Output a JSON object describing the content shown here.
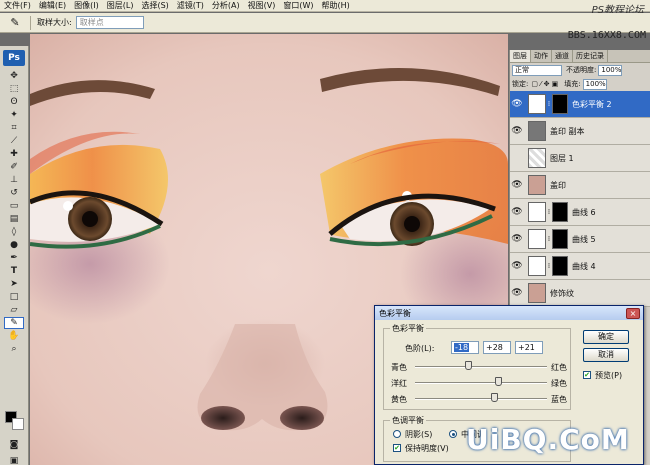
{
  "menubar": {
    "items": [
      "文件(F)",
      "编辑(E)",
      "图像(I)",
      "图层(L)",
      "选择(S)",
      "滤镜(T)",
      "分析(A)",
      "视图(V)",
      "窗口(W)",
      "帮助(H)"
    ],
    "watermark": "PS教程论坛"
  },
  "options": {
    "sample_size_label": "取样大小:",
    "sample_size_value": "取样点",
    "watermark": "BBS.16XX8.COM"
  },
  "toolbox": {
    "logo": "Ps"
  },
  "layers_panel": {
    "tabs": [
      "图层",
      "动作",
      "通道",
      "历史记录"
    ],
    "blend_mode": "正常",
    "opacity_label": "不透明度:",
    "opacity_value": "100%",
    "lock_label": "锁定:",
    "fill_label": "填充:",
    "fill_value": "100%",
    "layers": [
      {
        "name": "色彩平衡 2",
        "selected": true
      },
      {
        "name": "盖印 副本",
        "selected": false
      },
      {
        "name": "图层 1",
        "selected": false
      },
      {
        "name": "盖印",
        "selected": false
      },
      {
        "name": "曲线 6",
        "selected": false
      },
      {
        "name": "曲线 5",
        "selected": false
      },
      {
        "name": "曲线 4",
        "selected": false
      },
      {
        "name": "修饰纹",
        "selected": false
      }
    ]
  },
  "dialog": {
    "title": "色彩平衡",
    "balance_group": "色彩平衡",
    "levels_label": "色阶(L):",
    "levels": [
      "-18",
      "+28",
      "+21"
    ],
    "sliders": [
      {
        "left": "青色",
        "right": "红色",
        "value": -18
      },
      {
        "left": "洋红",
        "right": "绿色",
        "value": 28
      },
      {
        "left": "黄色",
        "right": "蓝色",
        "value": 21
      }
    ],
    "tone_group": "色调平衡",
    "shadows_label": "阴影(S)",
    "midtones_label": "中间调",
    "preserve_label": "保持明度(V)",
    "ok_label": "确定",
    "cancel_label": "取消",
    "preview_label": "预览(P)"
  },
  "bottom_watermark": "UiBQ.CoM"
}
